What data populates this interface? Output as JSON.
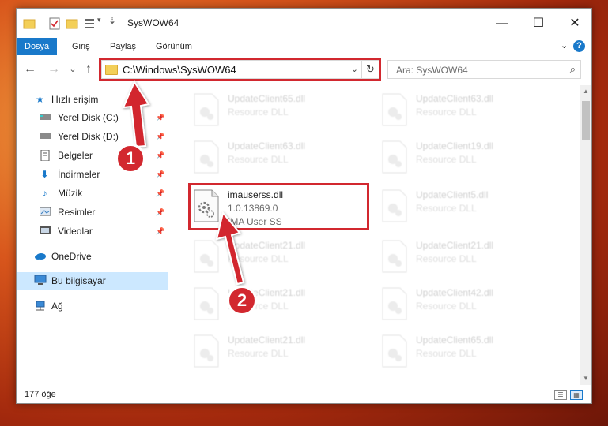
{
  "window": {
    "title": "SysWOW64",
    "minimize": "—",
    "maximize": "☐",
    "close": "✕"
  },
  "ribbon": {
    "tabs": [
      {
        "label": "Dosya",
        "active": true
      },
      {
        "label": "Giriş"
      },
      {
        "label": "Paylaş"
      },
      {
        "label": "Görünüm"
      }
    ],
    "collapse": "⌄",
    "help": "?"
  },
  "navigation": {
    "back": "←",
    "forward": "→",
    "recent": "⌄",
    "up": "↑"
  },
  "address": {
    "path": "C:\\Windows\\SysWOW64",
    "dropdown": "⌄",
    "refresh": "↻"
  },
  "search": {
    "placeholder": "Ara: SysWOW64",
    "icon": "⌕"
  },
  "sidebar": {
    "items": [
      {
        "label": "Hızlı erişim",
        "icon": "star-icon",
        "pinned": false
      },
      {
        "label": "Yerel Disk (C:)",
        "icon": "drive-icon",
        "pinned": true
      },
      {
        "label": "Yerel Disk (D:)",
        "icon": "drive-icon",
        "pinned": true
      },
      {
        "label": "Belgeler",
        "icon": "documents-icon",
        "pinned": true
      },
      {
        "label": "İndirmeler",
        "icon": "download-icon",
        "pinned": true
      },
      {
        "label": "Müzik",
        "icon": "music-icon",
        "pinned": true
      },
      {
        "label": "Resimler",
        "icon": "pictures-icon",
        "pinned": true
      },
      {
        "label": "Videolar",
        "icon": "videos-icon",
        "pinned": true
      },
      {
        "label": "OneDrive",
        "icon": "cloud-icon"
      },
      {
        "label": "Bu bilgisayar",
        "icon": "computer-icon",
        "selected": true
      },
      {
        "label": "Ağ",
        "icon": "network-icon"
      }
    ],
    "pin_glyph": "📌"
  },
  "files": [
    {
      "name": "UpdateClient65.dll",
      "desc": "Resource DLL",
      "faded": true
    },
    {
      "name": "UpdateClient63.dll",
      "desc": "Resource DLL",
      "faded": true
    },
    {
      "name": "UpdateClient63.dll",
      "desc": "Resource DLL",
      "faded": true
    },
    {
      "name": "UpdateClient19.dll",
      "desc": "Resource DLL",
      "faded": true
    },
    {
      "name": "imauserss.dll",
      "version": "1.0.13869.0",
      "desc": "IMA User SS",
      "faded": false
    },
    {
      "name": "UpdateClient5.dll",
      "desc": "Resource DLL",
      "faded": true
    },
    {
      "name": "UpdateClient21.dll",
      "desc": "Resource DLL",
      "faded": true
    },
    {
      "name": "UpdateClient21.dll",
      "desc": "Resource DLL",
      "faded": true
    },
    {
      "name": "UpdateClient21.dll",
      "desc": "Resource DLL",
      "faded": true
    },
    {
      "name": "UpdateClient42.dll",
      "desc": "Resource DLL",
      "faded": true
    },
    {
      "name": "UpdateClient21.dll",
      "desc": "Resource DLL",
      "faded": true
    },
    {
      "name": "UpdateClient65.dll",
      "desc": "Resource DLL",
      "faded": true
    }
  ],
  "status": {
    "count": "177 öğe"
  },
  "callouts": {
    "one": "1",
    "two": "2"
  },
  "colors": {
    "accent": "#1979ca",
    "highlight": "#d2282f",
    "selection": "#cce8ff"
  }
}
